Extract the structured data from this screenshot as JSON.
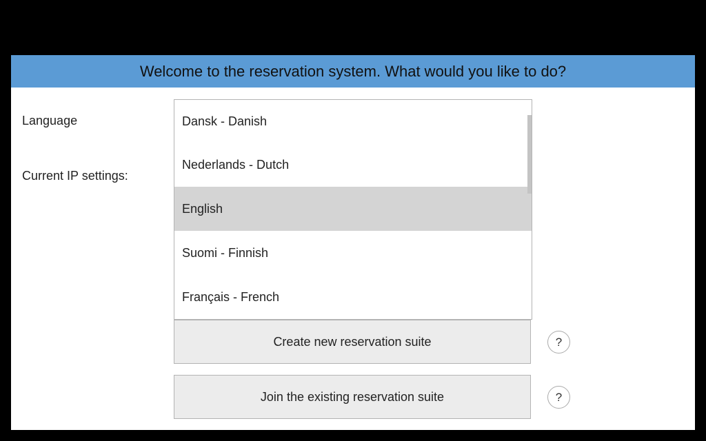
{
  "header": {
    "title": "Welcome to the reservation system. What would you like to do?"
  },
  "labels": {
    "language": "Language",
    "ip_settings": "Current IP settings:"
  },
  "language_list": {
    "items": [
      {
        "label": "Dansk - Danish"
      },
      {
        "label": "Nederlands - Dutch"
      },
      {
        "label": "English"
      },
      {
        "label": "Suomi - Finnish"
      },
      {
        "label": "Français - French"
      }
    ],
    "selected": "English"
  },
  "actions": {
    "create_label": "Create new reservation suite",
    "join_label": "Join the existing reservation suite",
    "help_label": "?"
  },
  "colors": {
    "header_bg": "#5b9bd5",
    "selected_bg": "#d4d4d4",
    "button_bg": "#ececec"
  }
}
